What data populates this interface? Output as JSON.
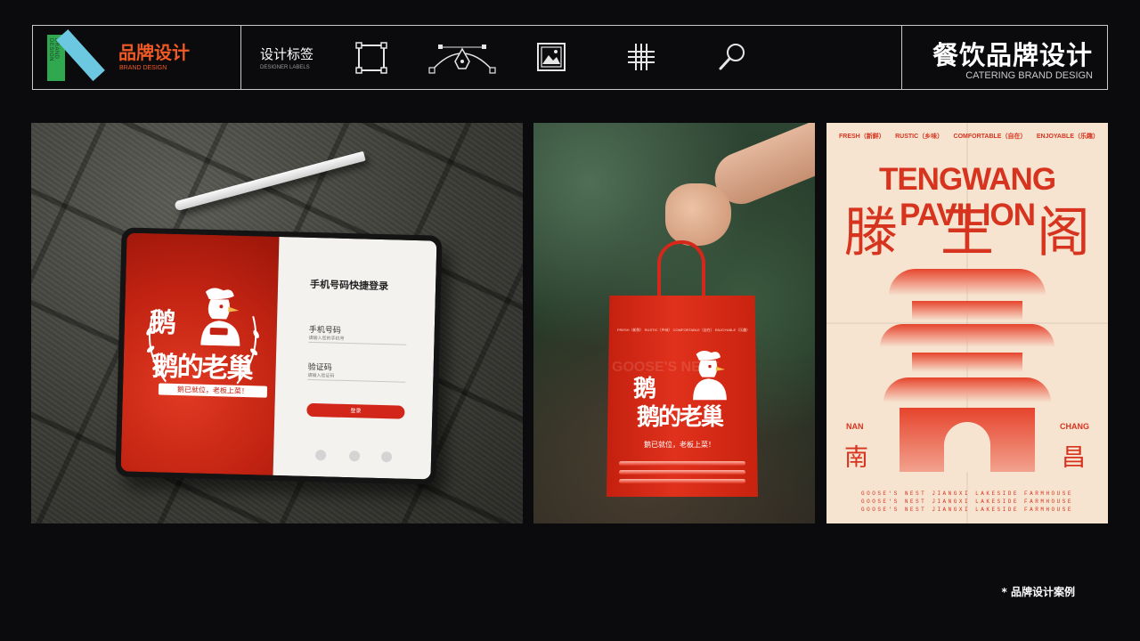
{
  "header": {
    "brand_title": "品牌设计",
    "brand_subtitle": "BRAND DESIGN",
    "logo_vertical_text": "BRAND DESIGN",
    "tools_title": "设计标签",
    "tools_subtitle": "DESIGNER LABELS",
    "tool_icons": [
      "crop-frame-icon",
      "pen-bezier-icon",
      "image-icon",
      "grid-icon",
      "search-icon"
    ],
    "right_title": "餐饮品牌设计",
    "right_subtitle": "CATERING BRAND DESIGN"
  },
  "tablet": {
    "logo_line1": "鹅",
    "logo_line2": "鹅的老巢",
    "slogan": "鹅已就位，老板上菜！",
    "login_title": "手机号码快捷登录",
    "phone_label": "手机号码",
    "phone_placeholder": "请输入您的手机号",
    "code_label": "验证码",
    "code_placeholder": "请输入验证码",
    "login_button": "登录"
  },
  "bag": {
    "top_text": "FRESH（新鲜）  RUSTIC（乡味）  COMFORTABLE（自在）  ENJOYABLE（乐趣）",
    "ghost_text": "GOOSE'S NEST",
    "logo_line1": "鹅",
    "logo_line2": "鹅的老巢",
    "slogan": "鹅已就位，老板上菜！"
  },
  "poster": {
    "tags": [
      "FRESH（新鲜）",
      "RUSTIC（乡味）",
      "COMFORTABLE（自在）",
      "ENJOYABLE（乐趣）"
    ],
    "title_en": "TENGWANG PAVILION",
    "title_cn": [
      "滕",
      "王",
      "阁"
    ],
    "city_left_en": "NAN",
    "city_left_cn": "南",
    "city_right_en": "CHANG",
    "city_right_cn": "昌",
    "footer_lines": [
      "GOOSE'S NEST JIANGXI LAKESIDE FARMHOUSE",
      "GOOSE'S NEST JIANGXI LAKESIDE FARMHOUSE",
      "GOOSE'S NEST JIANGXI LAKESIDE FARMHOUSE"
    ]
  },
  "caption": "* 品牌设计案例",
  "colors": {
    "background": "#0b0b0e",
    "accent_orange": "#f15a24",
    "brand_red": "#d7341f",
    "logo_green": "#2fa84f",
    "logo_blue": "#6cc7e0",
    "poster_paper": "#f6e4d0"
  }
}
